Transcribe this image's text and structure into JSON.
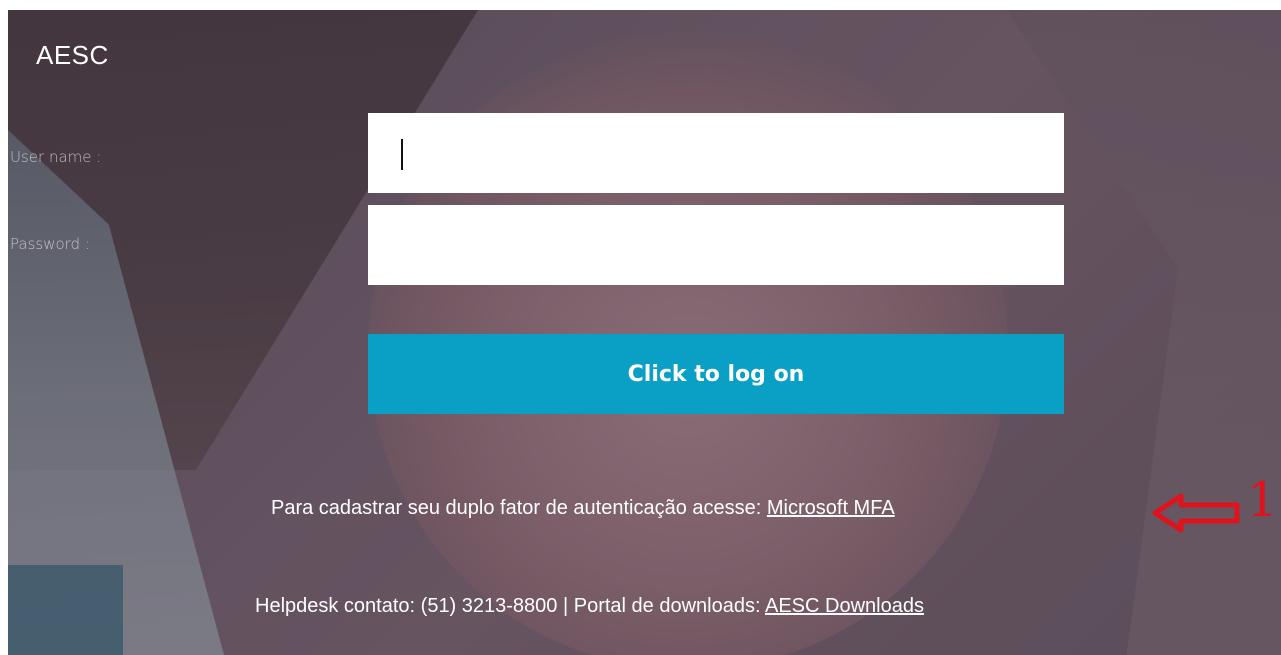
{
  "brand": {
    "name": "AESC"
  },
  "login_form": {
    "username_label": "User name :",
    "username_value": "",
    "password_label": "Password :",
    "password_value": "",
    "submit_label": "Click to log on"
  },
  "mfa": {
    "text": "Para cadastrar seu duplo fator de autenticação acesse:",
    "link_label": "Microsoft MFA"
  },
  "helpdesk": {
    "text": "Helpdesk contato: (51) 3213-8800",
    "separator": "|",
    "portal_text": "Portal de downloads:",
    "link_label": "AESC Downloads"
  },
  "annotation": {
    "number": "1",
    "color": "#e0121c",
    "icon": "left-arrow-icon"
  },
  "colors": {
    "button": "#0aa0c6",
    "text": "#ffffff"
  }
}
